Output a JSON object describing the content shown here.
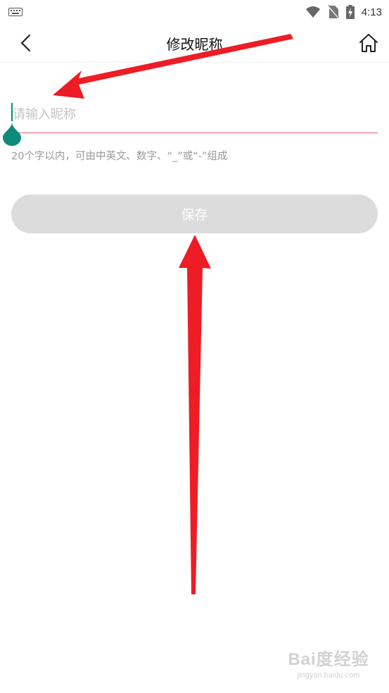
{
  "status_bar": {
    "time": "4:13",
    "icons": [
      "keyboard-icon",
      "wifi-icon",
      "no-sim-icon",
      "battery-charging-icon"
    ]
  },
  "header": {
    "title": "修改昵称",
    "back_icon": "chevron-left-icon",
    "home_icon": "home-icon"
  },
  "form": {
    "nickname_placeholder": "请输入昵称",
    "nickname_value": "",
    "hint": "20个字以内，可由中英文、数字、“_”或“-”组成",
    "save_label": "保存"
  },
  "annotations": {
    "arrow_color": "#ee1c25"
  },
  "watermark": {
    "brand": "Bai度经验",
    "url": "jingyan.baidu.com"
  },
  "colors": {
    "accent_line": "#e4626c",
    "cursor": "#0e8a78",
    "button_disabled": "#dcdcdc"
  }
}
